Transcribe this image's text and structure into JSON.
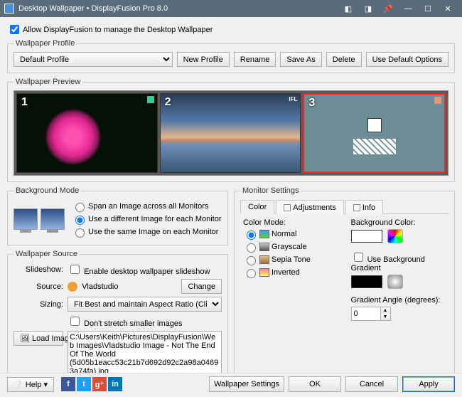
{
  "window": {
    "title": "Desktop Wallpaper • DisplayFusion Pro 8.0"
  },
  "allow_manage": {
    "checked": true,
    "label": "Allow DisplayFusion to manage the Desktop Wallpaper"
  },
  "profile": {
    "legend": "Wallpaper Profile",
    "selected": "Default Profile",
    "buttons": {
      "new": "New Profile",
      "rename": "Rename",
      "saveas": "Save As",
      "delete": "Delete",
      "defaults": "Use Default Options"
    }
  },
  "preview": {
    "legend": "Wallpaper Preview",
    "monitors": [
      {
        "num": "1",
        "tag": ""
      },
      {
        "num": "2",
        "tag": "IFL"
      },
      {
        "num": "3",
        "tag": ""
      }
    ],
    "selected_index": 2
  },
  "bgmode": {
    "legend": "Background Mode",
    "options": {
      "span": "Span an Image across all Monitors",
      "diff": "Use a different Image for each Monitor",
      "same": "Use the same Image on each Monitor"
    },
    "selected": "diff"
  },
  "source": {
    "legend": "Wallpaper Source",
    "slideshow_label": "Slideshow:",
    "slideshow_checkbox": "Enable desktop wallpaper slideshow",
    "slideshow_checked": false,
    "source_label": "Source:",
    "source_value": "Vladstudio",
    "change": "Change",
    "sizing_label": "Sizing:",
    "sizing_value": "Fit Best and maintain Aspect Ratio (Clip Edges)",
    "dont_stretch": "Don't stretch smaller images",
    "dont_stretch_checked": false,
    "load_image": "Load Image",
    "path": "C:\\Users\\Keith\\Pictures\\DisplayFusion\\Web Images\\Vladstudio Image - Not The End Of The World (5d05b1eacc53c21b7d692d92c2a98a04693a74fa).jpg"
  },
  "monitor_settings": {
    "legend": "Monitor Settings",
    "tabs": {
      "color": "Color",
      "adjustments": "Adjustments",
      "info": "Info"
    },
    "active_tab": "color",
    "color_mode_label": "Color Mode:",
    "color_modes": {
      "normal": "Normal",
      "grayscale": "Grayscale",
      "sepia": "Sepia Tone",
      "inverted": "Inverted"
    },
    "color_mode_selected": "normal",
    "bg_color_label": "Background Color:",
    "bg_color_value": "#ffffff",
    "use_gradient_label": "Use Background Gradient",
    "use_gradient_checked": false,
    "gradient_color": "#000000",
    "gradient_angle_label": "Gradient Angle (degrees):",
    "gradient_angle_value": "0"
  },
  "footer": {
    "help": "Help",
    "wallpaper_settings": "Wallpaper Settings",
    "ok": "OK",
    "cancel": "Cancel",
    "apply": "Apply"
  }
}
